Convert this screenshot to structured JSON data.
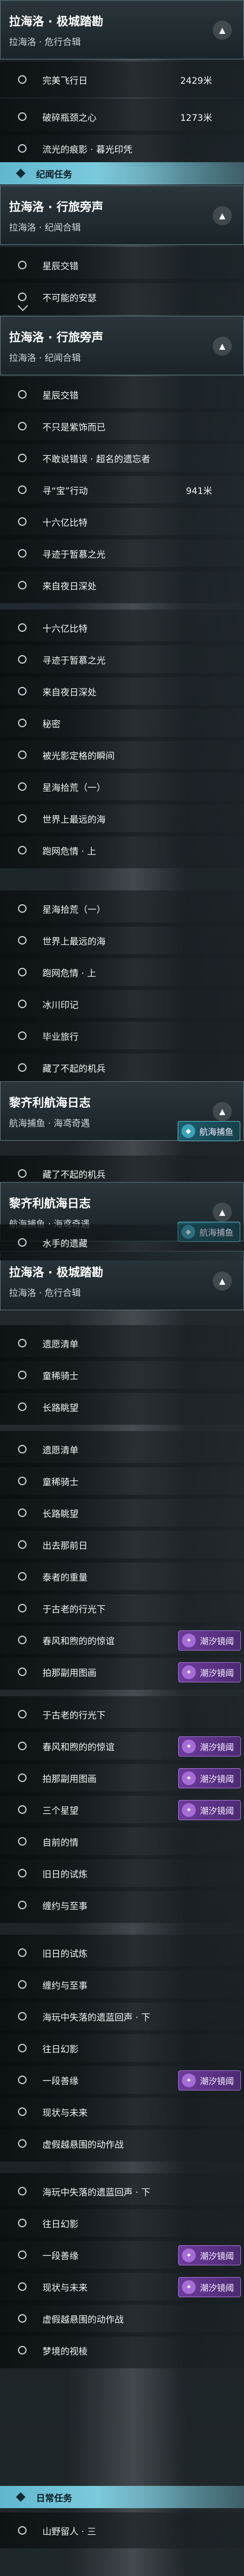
{
  "groups": [
    {
      "title": "拉海洛 · 极城踏勘",
      "subtitle": "拉海洛 · 危行合辑",
      "chev": "▲"
    },
    {
      "title": "拉海洛 · 行旅旁声",
      "subtitle": "拉海洛 · 纪闻合辑",
      "chev": "▲"
    },
    {
      "title": "拉海洛 · 行旅旁声",
      "subtitle": "拉海洛 · 纪闻合辑",
      "chev": "▲"
    },
    {
      "title": "黎齐利航海日志",
      "subtitle": "航海捕鱼 · 海鸢奇遇",
      "chev": "▲"
    },
    {
      "title": "黎齐利航海日志",
      "subtitle": "航海捕鱼 · 海鸢奇遇",
      "chev": "▲"
    },
    {
      "title": "拉海洛 · 极城踏勘",
      "subtitle": "拉海洛 · 危行合辑",
      "chev": "▲"
    }
  ],
  "sections": [
    {
      "label": "纪闻任务"
    },
    {
      "label": "日常任务"
    }
  ],
  "badges": {
    "purple": "潮汐镜阈",
    "teal": "航海捕鱼"
  },
  "items": [
    {
      "label": "完美飞行日",
      "dist": "2429米"
    },
    {
      "label": "破碎瓶颈之心",
      "dist": "1273米"
    },
    {
      "label": "流光的痕影 · 暮光印凭"
    },
    {
      "label": "星辰交错"
    },
    {
      "label": "不可能的安瑟"
    },
    {
      "label": "星辰交错"
    },
    {
      "label": "不只是紫饰而已"
    },
    {
      "label": "不敢说错误 · 超名的遗忘者"
    },
    {
      "label": "寻“宝”行动",
      "dist": "941米"
    },
    {
      "label": "十六亿比特"
    },
    {
      "label": "寻迹于暂慕之光"
    },
    {
      "label": "来自夜日深处"
    },
    {
      "label": "十六亿比特"
    },
    {
      "label": "寻迹于暂慕之光"
    },
    {
      "label": "来自夜日深处"
    },
    {
      "label": "秘密"
    },
    {
      "label": "被光影定格的瞬间"
    },
    {
      "label": "星海拾荒（一）"
    },
    {
      "label": "世界上最远的海"
    },
    {
      "label": "跑网危情 · 上"
    },
    {
      "label": "星海拾荒（一）"
    },
    {
      "label": "世界上最远的海"
    },
    {
      "label": "跑网危情 · 上"
    },
    {
      "label": "冰川印记"
    },
    {
      "label": "毕业旅行"
    },
    {
      "label": "藏了不起的机兵"
    },
    {
      "label": "藏了不起的机兵"
    },
    {
      "label": "水手的遗藏"
    },
    {
      "label": "遗愿清单"
    },
    {
      "label": "童稀骑士"
    },
    {
      "label": "长路眺望"
    },
    {
      "label": "遗愿清单"
    },
    {
      "label": "童稀骑士"
    },
    {
      "label": "长路眺望"
    },
    {
      "label": "出去那前日"
    },
    {
      "label": "泰者的重量"
    },
    {
      "label": "于古老的行光下"
    },
    {
      "label": "春风和煦的的惊谊"
    },
    {
      "label": "拍那副用图画"
    },
    {
      "label": "于古老的行光下"
    },
    {
      "label": "春风和煦的的惊谊"
    },
    {
      "label": "拍那副用图画"
    },
    {
      "label": "三个星望"
    },
    {
      "label": "自前的情"
    },
    {
      "label": "旧日的试炼"
    },
    {
      "label": "缠约与至事"
    },
    {
      "label": "旧日的试炼"
    },
    {
      "label": "缠约与至事"
    },
    {
      "label": "海玩中失落的遗蓝回声 · 下"
    },
    {
      "label": "往日幻影"
    },
    {
      "label": "一段善缘"
    },
    {
      "label": "现状与未来"
    },
    {
      "label": "虚假越悬围的动作战"
    },
    {
      "label": "海玩中失落的遗蓝回声 · 下"
    },
    {
      "label": "往日幻影"
    },
    {
      "label": "一段善缘"
    },
    {
      "label": "现状与未来"
    },
    {
      "label": "虚假越悬围的动作战"
    },
    {
      "label": "梦境的视棱"
    },
    {
      "label": "山野留人 · 三"
    }
  ]
}
